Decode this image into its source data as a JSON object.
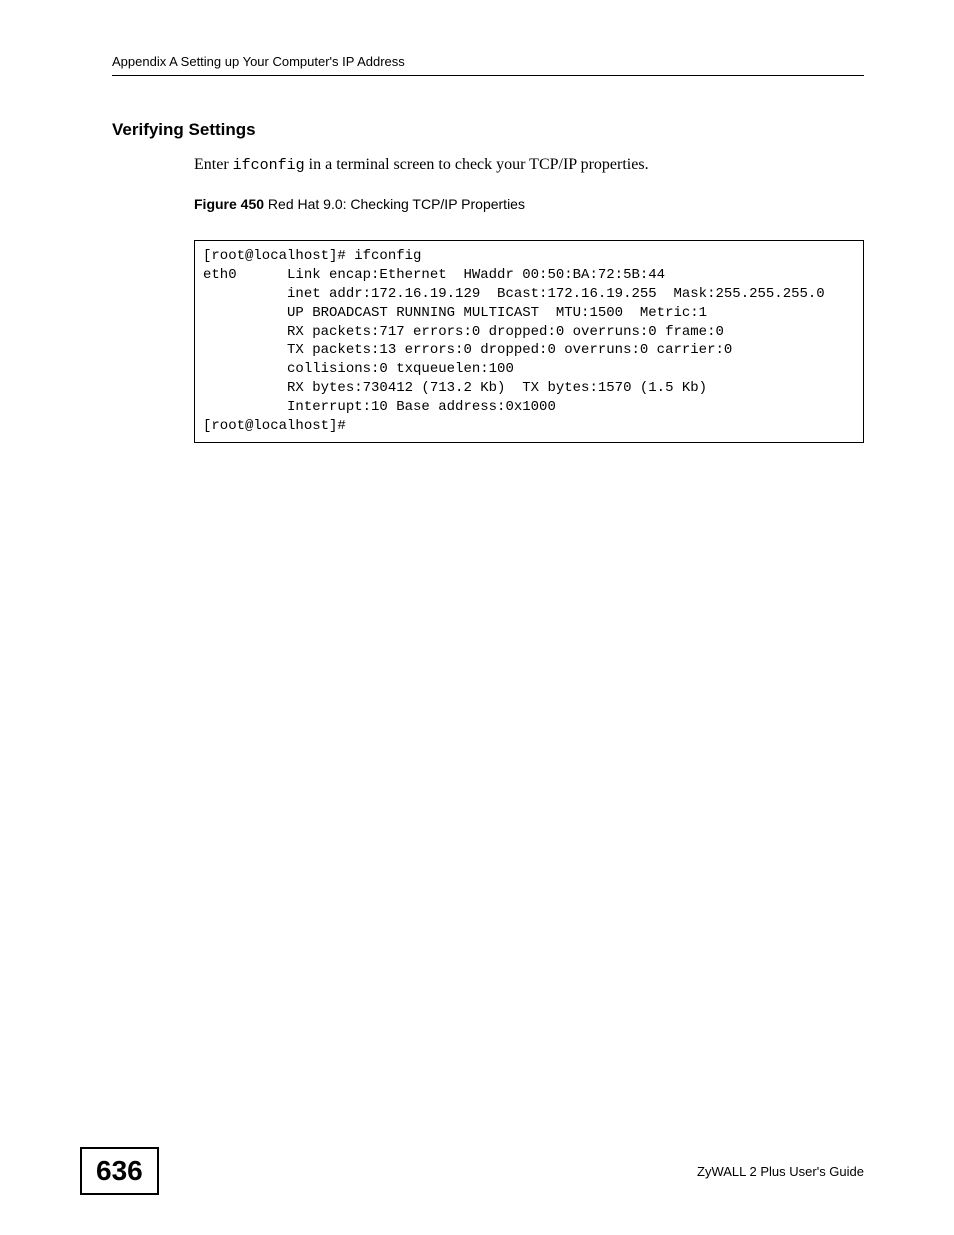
{
  "header": {
    "running_title": "Appendix A Setting up Your Computer's IP Address"
  },
  "section": {
    "heading": "Verifying Settings",
    "body_pre": "Enter ",
    "body_code": "ifconfig",
    "body_post": " in a terminal screen to check your TCP/IP properties."
  },
  "figure": {
    "label": "Figure 450",
    "caption": "   Red Hat 9.0: Checking TCP/IP Properties"
  },
  "terminal": {
    "lines": [
      "[root@localhost]# ifconfig ",
      "eth0      Link encap:Ethernet  HWaddr 00:50:BA:72:5B:44  ",
      "          inet addr:172.16.19.129  Bcast:172.16.19.255  Mask:255.255.255.0",
      "          UP BROADCAST RUNNING MULTICAST  MTU:1500  Metric:1",
      "          RX packets:717 errors:0 dropped:0 overruns:0 frame:0",
      "          TX packets:13 errors:0 dropped:0 overruns:0 carrier:0",
      "          collisions:0 txqueuelen:100 ",
      "          RX bytes:730412 (713.2 Kb)  TX bytes:1570 (1.5 Kb)",
      "          Interrupt:10 Base address:0x1000 ",
      "[root@localhost]#"
    ]
  },
  "footer": {
    "page_number": "636",
    "guide_title": "ZyWALL 2 Plus User's Guide"
  }
}
